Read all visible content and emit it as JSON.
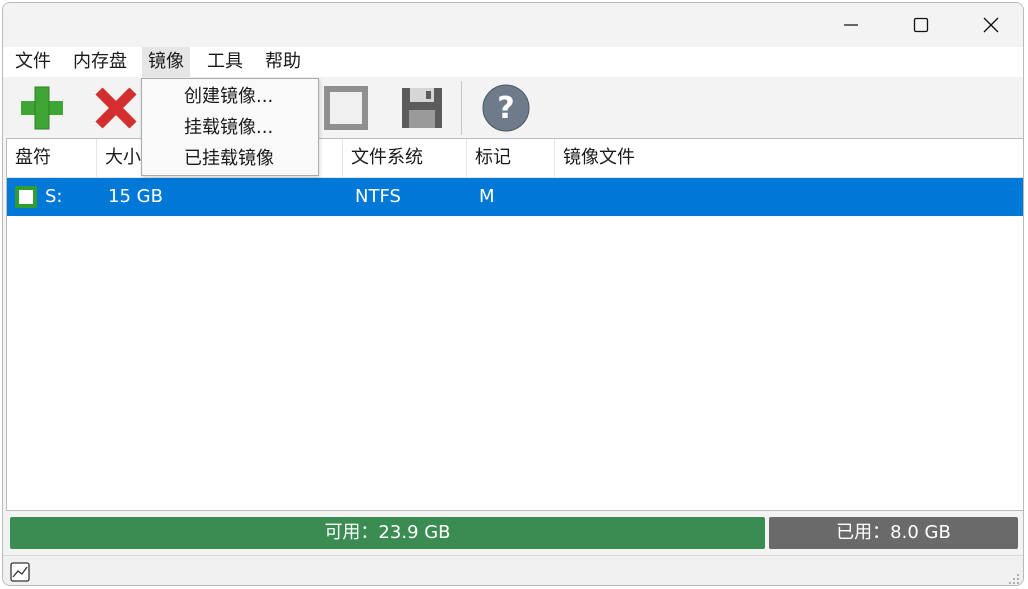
{
  "window": {
    "controls": [
      "minimize-icon",
      "maximize-icon",
      "close-icon"
    ]
  },
  "menu": {
    "file": "文件",
    "ramdisk": "内存盘",
    "image": "镜像",
    "tools": "工具",
    "help": "帮助"
  },
  "image_menu": {
    "items": [
      "创建镜像...",
      "挂载镜像...",
      "已挂载镜像"
    ]
  },
  "toolbar": {
    "icons": [
      "add-icon",
      "remove-icon",
      "stop-icon",
      "save-icon",
      "help-icon"
    ],
    "colors": {
      "add": "#3fa535",
      "remove": "#d32f2f",
      "help": "#6d7b8a"
    }
  },
  "table": {
    "columns": [
      "盘符",
      "大小",
      "文件系统",
      "标记",
      "镜像文件"
    ],
    "rows": [
      {
        "drive": "S:",
        "size": "15 GB",
        "filesystem": "NTFS",
        "flag": "M",
        "image_file": "",
        "checked": true
      }
    ],
    "selected_row_color": "#0078d7"
  },
  "usage": {
    "free_label": "可用：23.9 GB",
    "used_label": "已用：8.0 GB",
    "free_color": "#3a8c52",
    "used_color": "#6a6a6a"
  },
  "statusbar": {
    "icon": "chart-icon"
  }
}
